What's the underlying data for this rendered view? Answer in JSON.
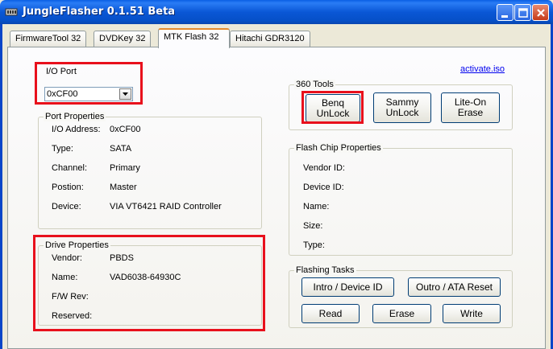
{
  "window": {
    "title": "JungleFlasher 0.1.51 Beta"
  },
  "tabs": [
    {
      "label": "FirmwareTool 32",
      "active": false
    },
    {
      "label": "DVDKey 32",
      "active": false
    },
    {
      "label": "MTK Flash 32",
      "active": true
    },
    {
      "label": "Hitachi GDR3120",
      "active": false
    }
  ],
  "io_port": {
    "label": "I/O Port",
    "value": "0xCF00"
  },
  "activate_link": "activate.iso",
  "port_properties": {
    "title": "Port Properties",
    "rows": [
      {
        "label": "I/O Address:",
        "value": "0xCF00"
      },
      {
        "label": "Type:",
        "value": "SATA"
      },
      {
        "label": "Channel:",
        "value": "Primary"
      },
      {
        "label": "Postion:",
        "value": "Master"
      },
      {
        "label": "Device:",
        "value": "VIA VT6421 RAID Controller"
      }
    ]
  },
  "drive_properties": {
    "title": "Drive Properties",
    "rows": [
      {
        "label": "Vendor:",
        "value": "PBDS"
      },
      {
        "label": "Name:",
        "value": "VAD6038-64930C"
      },
      {
        "label": "F/W Rev:",
        "value": ""
      },
      {
        "label": "Reserved:",
        "value": ""
      }
    ]
  },
  "tools_360": {
    "title": "360 Tools",
    "buttons": [
      {
        "line1": "Benq",
        "line2": "UnLock"
      },
      {
        "line1": "Sammy",
        "line2": "UnLock"
      },
      {
        "line1": "Lite-On",
        "line2": "Erase"
      }
    ]
  },
  "flash_chip": {
    "title": "Flash Chip Properties",
    "rows": [
      {
        "label": "Vendor ID:"
      },
      {
        "label": "Device ID:"
      },
      {
        "label": "Name:"
      },
      {
        "label": "Size:"
      },
      {
        "label": "Type:"
      }
    ]
  },
  "flashing_tasks": {
    "title": "Flashing Tasks",
    "intro": "Intro / Device ID",
    "outro": "Outro / ATA Reset",
    "read": "Read",
    "erase": "Erase",
    "write": "Write"
  },
  "colors": {
    "titlebar": "#0a57d6",
    "highlight_box": "#e8101c",
    "link": "#0000ee"
  }
}
